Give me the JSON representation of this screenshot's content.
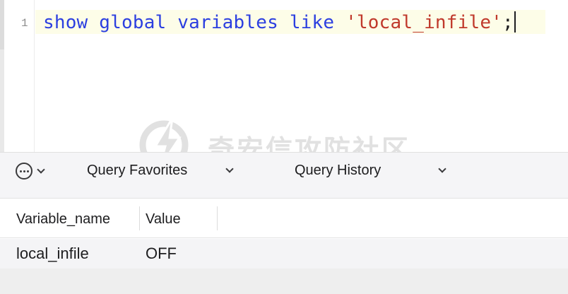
{
  "editor": {
    "line_number": "1",
    "code": {
      "kw1": "show",
      "kw2": "global",
      "kw3": "variables",
      "kw4": "like",
      "string": "'local_infile'",
      "terminator": ";"
    }
  },
  "toolbar": {
    "more_icon": "ellipsis-circle-icon",
    "favorites_label": "Query Favorites",
    "history_label": "Query History"
  },
  "watermark": {
    "text": "奇安信攻防社区"
  },
  "results": {
    "columns": [
      "Variable_name",
      "Value"
    ],
    "rows": [
      [
        "local_infile",
        "OFF"
      ]
    ]
  },
  "colors": {
    "keyword": "#2c3fe0",
    "string": "#c0392b",
    "current_line": "#fdfde8",
    "toolbar_bg": "#f5f5f7"
  }
}
